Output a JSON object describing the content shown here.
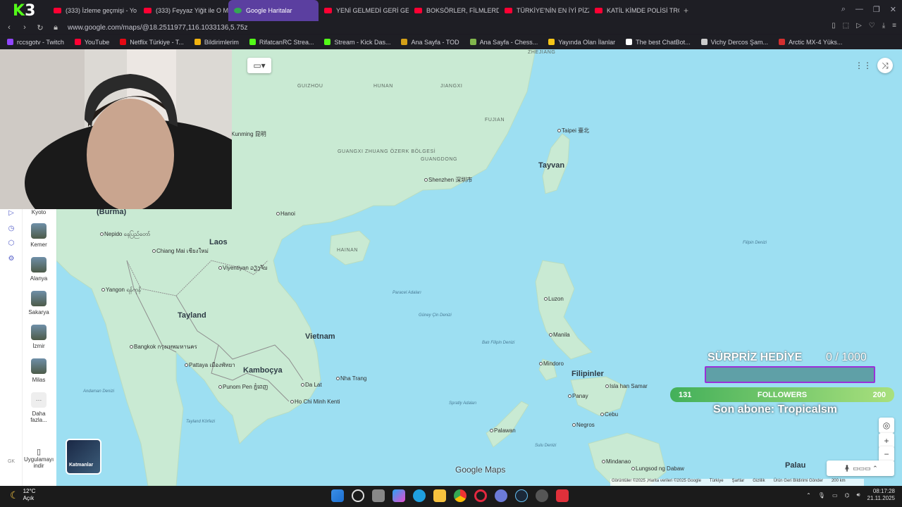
{
  "browser": {
    "brand_letter": "K",
    "brand_number": "3",
    "tabs": [
      {
        "label": "(333) İzleme geçmişi - Yo",
        "active": false
      },
      {
        "label": "(333) Feyyaz Yiğit ile O M",
        "active": false
      },
      {
        "label": "Google Haritalar",
        "active": true
      },
      {
        "label": "YENİ GELMEDİ GERİ GELİ",
        "active": false
      },
      {
        "label": "BOKSÖRLER, FİLMLERDE",
        "active": false
      },
      {
        "label": "TÜRKİYE'NİN EN İYİ PİZZ",
        "active": false
      },
      {
        "label": "KATİL KİMDE POLİSİ TROL",
        "active": false
      }
    ],
    "new_tab_label": "+",
    "url": "www.google.com/maps/@18.2511977,116.1033136,5.75z",
    "bookmarks": [
      {
        "label": "rccsgotv - Twitch",
        "color": "#9146ff"
      },
      {
        "label": "YouTube",
        "color": "#ff0033"
      },
      {
        "label": "Netflix Türkiye - T...",
        "color": "#e50914"
      },
      {
        "label": "Bildirimlerim",
        "color": "#f2b30f"
      },
      {
        "label": "RifatcanRC Strea...",
        "color": "#53fc18"
      },
      {
        "label": "Stream - Kick Das...",
        "color": "#53fc18"
      },
      {
        "label": "Ana Sayfa - TOD",
        "color": "#d4a017"
      },
      {
        "label": "Ana Sayfa - Chess...",
        "color": "#81b64c"
      },
      {
        "label": "Yayında Olan İlanlar",
        "color": "#f5c518"
      },
      {
        "label": "The best ChatBot...",
        "color": "#ffffff"
      },
      {
        "label": "Vichy Dercos Şam...",
        "color": "#cccccc"
      },
      {
        "label": "Arctic MX-4 Yüks...",
        "color": "#d32f2f"
      }
    ]
  },
  "map": {
    "countries": [
      "(Burma)",
      "Laos",
      "Tayland",
      "Vietnam",
      "Kamboçya",
      "Tayvan",
      "Filipinler",
      "Palau"
    ],
    "provinces": [
      "ZHEJIANG",
      "GUIZHOU",
      "HUNAN",
      "JIANGXI",
      "FUJIAN",
      "GUANGXI ZHUANG ÖZERK BÖLGESİ",
      "GUANGDONG",
      "HAINAN"
    ],
    "cities": [
      {
        "name": "Kunming 昆明"
      },
      {
        "name": "Hanoi"
      },
      {
        "name": "Shenzhen 深圳市"
      },
      {
        "name": "Taipei 臺北"
      },
      {
        "name": "Nepido နေပြည်တော်"
      },
      {
        "name": "Chiang Mai เชียงใหม่"
      },
      {
        "name": "Viyentiyan ວຽງຈັນ"
      },
      {
        "name": "Yangon ရန်ကုန်"
      },
      {
        "name": "Bangkok กรุงเทพมหานคร"
      },
      {
        "name": "Pattaya เมืองพัทยา"
      },
      {
        "name": "Punom Pen ភ្នំពេញ"
      },
      {
        "name": "Ho Chi Minh Kenti"
      },
      {
        "name": "Da Lat"
      },
      {
        "name": "Nha Trang"
      },
      {
        "name": "Manila"
      },
      {
        "name": "Luzon"
      },
      {
        "name": "Mindoro"
      },
      {
        "name": "Cebu"
      },
      {
        "name": "Panay"
      },
      {
        "name": "Negros"
      },
      {
        "name": "Palawan"
      },
      {
        "name": "Mindanao"
      },
      {
        "name": "Lungsod ng Dabaw"
      },
      {
        "name": "Isla han Samar"
      }
    ],
    "seas": [
      "Paracel Adaları",
      "Güney Çin Denizi",
      "Batı Filipin Denizi",
      "Spratly Adaları",
      "Sulu Denizi",
      "Filipin Denizi",
      "Andaman Denizi",
      "Tayland Körfezi"
    ],
    "google_maps_label": "Google Maps",
    "attribution": [
      "Görüntüler ©2025 ,Harita verileri ©2025 Google",
      "Türkiye",
      "Şartlar",
      "Gizlilik",
      "Ürün Geri Bildirimi Gönder",
      "200 km"
    ],
    "layers_label": "Katmanlar"
  },
  "sidebar": {
    "top_label": "Kyoto",
    "places": [
      {
        "label": "Kemer"
      },
      {
        "label": "Alanya"
      },
      {
        "label": "Sakarya"
      },
      {
        "label": "İzmir"
      },
      {
        "label": "Milas"
      }
    ],
    "more_label": "Daha fazla...",
    "app_label": "Uygulamayı indir"
  },
  "stream_overlay": {
    "gift_title": "SÜRPRİZ HEDİYE",
    "gift_count": "0  / 1000",
    "followers_current": "131",
    "followers_label": "FOLLOWERS",
    "followers_goal": "200",
    "last_sub": "Son abone: Tropicalsm"
  },
  "taskbar": {
    "temperature": "12°C",
    "weather_text": "Açık",
    "time": "08:17:28",
    "date": "21.11.2025"
  }
}
